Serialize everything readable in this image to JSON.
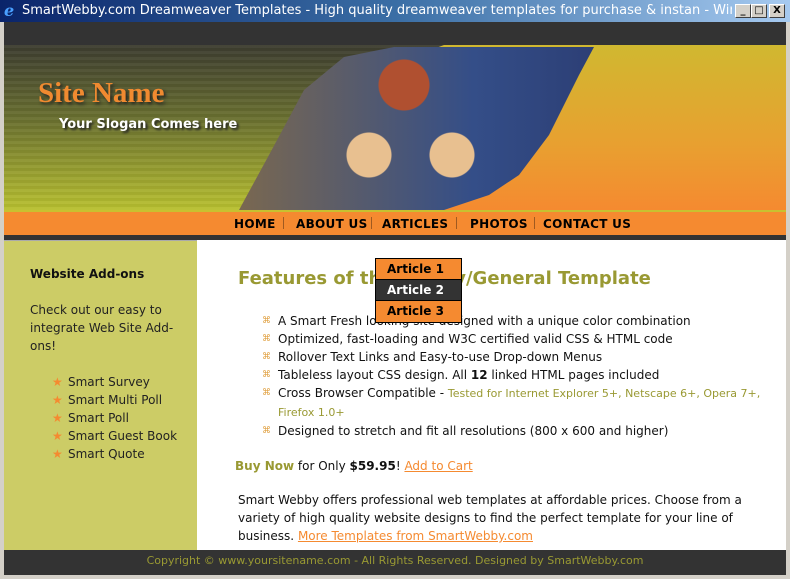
{
  "window": {
    "title": "SmartWebby.com Dreamweaver Templates - High quality dreamweaver templates for purchase & instan - Windows Interne...",
    "minimize": "_",
    "maximize": "□",
    "close": "X",
    "icon": "ie-icon"
  },
  "header": {
    "site_name": "Site Name",
    "slogan": "Your Slogan Comes here"
  },
  "nav": {
    "items": [
      {
        "label": "HOME"
      },
      {
        "label": "ABOUT US"
      },
      {
        "label": "ARTICLES"
      },
      {
        "label": "PHOTOS"
      },
      {
        "label": "CONTACT US"
      }
    ],
    "dropdown": [
      {
        "label": "Article 1"
      },
      {
        "label": "Article 2",
        "active": true
      },
      {
        "label": "Article 3"
      }
    ]
  },
  "sidebar": {
    "heading": "Website Add-ons",
    "text": "Check out our easy to integrate Web Site Add-ons!",
    "items": [
      "Smart Survey",
      "Smart Multi Poll",
      "Smart Poll",
      "Smart Guest Book",
      "Smart Quote"
    ]
  },
  "main": {
    "heading": "Features of the Family/General Template",
    "features": [
      {
        "text": "A Smart Fresh looking site designed with a unique color combination"
      },
      {
        "text": "Optimized, fast-loading and W3C certified valid CSS & HTML code"
      },
      {
        "text": "Rollover Text Links and Easy-to-use Drop-down Menus"
      },
      {
        "pre": "Tableless layout CSS design. All ",
        "bold": "12",
        "post": " linked HTML pages included"
      },
      {
        "text": "Cross Browser Compatible - ",
        "note": "Tested for Internet Explorer 5+, Netscape 6+, Opera 7+, Firefox 1.0+"
      },
      {
        "text": "Designed to stretch and fit all resolutions (800 x 600 and higher)"
      }
    ],
    "buy_now": "Buy Now",
    "for_only": " for Only ",
    "price": "$59.95",
    "bang": "! ",
    "add_to_cart": "Add to Cart",
    "about": "Smart Webby offers professional web templates at affordable prices. Choose from a variety of high quality website designs to find the perfect template for your line of business. ",
    "more_link": "More Templates from SmartWebby.com"
  },
  "footer": {
    "text": "Copyright © www.yoursitename.com - All Rights Reserved. Designed by SmartWebby.com"
  },
  "colors": {
    "orange": "#f58a30",
    "olive": "#999933",
    "sidebar": "#cccc66",
    "dark": "#333333"
  }
}
